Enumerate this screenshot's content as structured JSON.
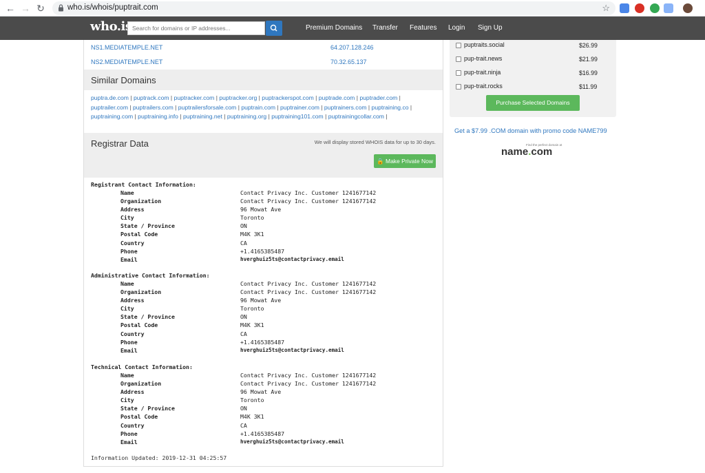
{
  "browser": {
    "url": "who.is/whois/puptrait.com"
  },
  "header": {
    "logo": "who.is",
    "search_placeholder": "Search for domains or IP addresses...",
    "nav": [
      "Premium Domains",
      "Transfer",
      "Features",
      "Login",
      "Sign Up"
    ]
  },
  "nameservers": [
    {
      "name": "NS1.MEDIATEMPLE.NET",
      "ip": "64.207.128.246"
    },
    {
      "name": "NS2.MEDIATEMPLE.NET",
      "ip": "70.32.65.137"
    }
  ],
  "similar": {
    "title": "Similar Domains",
    "domains": [
      "puptra.de.com",
      "puptrack.com",
      "puptracker.com",
      "puptracker.org",
      "puptrackerspot.com",
      "puptrade.com",
      "puptrader.com",
      "puptrailer.com",
      "puptrailers.com",
      "puptrailersforsale.com",
      "puptrain.com",
      "puptrainer.com",
      "puptrainers.com",
      "puptraining.co",
      "puptraining.com",
      "puptraining.info",
      "puptraining.net",
      "puptraining.org",
      "puptraining101.com",
      "puptrainingcollar.com"
    ]
  },
  "registrar": {
    "title": "Registrar Data",
    "note": "We will display stored WHOIS data for up to 30 days.",
    "private_button": "Make Private Now"
  },
  "contacts": [
    {
      "heading": "Registrant Contact Information:",
      "fields": [
        {
          "k": "Name",
          "v": "Contact Privacy Inc. Customer 1241677142"
        },
        {
          "k": "Organization",
          "v": "Contact Privacy Inc. Customer 1241677142"
        },
        {
          "k": "Address",
          "v": "96 Mowat Ave"
        },
        {
          "k": "City",
          "v": "Toronto"
        },
        {
          "k": "State / Province",
          "v": "ON"
        },
        {
          "k": "Postal Code",
          "v": "M4K 3K1"
        },
        {
          "k": "Country",
          "v": "CA"
        },
        {
          "k": "Phone",
          "v": "+1.4165385487"
        },
        {
          "k": "Email",
          "v": "hverghuiz5ts@contactprivacy.email"
        }
      ]
    },
    {
      "heading": "Administrative Contact Information:",
      "fields": [
        {
          "k": "Name",
          "v": "Contact Privacy Inc. Customer 1241677142"
        },
        {
          "k": "Organization",
          "v": "Contact Privacy Inc. Customer 1241677142"
        },
        {
          "k": "Address",
          "v": "96 Mowat Ave"
        },
        {
          "k": "City",
          "v": "Toronto"
        },
        {
          "k": "State / Province",
          "v": "ON"
        },
        {
          "k": "Postal Code",
          "v": "M4K 3K1"
        },
        {
          "k": "Country",
          "v": "CA"
        },
        {
          "k": "Phone",
          "v": "+1.4165385487"
        },
        {
          "k": "Email",
          "v": "hverghuiz5ts@contactprivacy.email"
        }
      ]
    },
    {
      "heading": "Technical Contact Information:",
      "fields": [
        {
          "k": "Name",
          "v": "Contact Privacy Inc. Customer 1241677142"
        },
        {
          "k": "Organization",
          "v": "Contact Privacy Inc. Customer 1241677142"
        },
        {
          "k": "Address",
          "v": "96 Mowat Ave"
        },
        {
          "k": "City",
          "v": "Toronto"
        },
        {
          "k": "State / Province",
          "v": "ON"
        },
        {
          "k": "Postal Code",
          "v": "M4K 3K1"
        },
        {
          "k": "Country",
          "v": "CA"
        },
        {
          "k": "Phone",
          "v": "+1.4165385487"
        },
        {
          "k": "Email",
          "v": "hverghuiz5ts@contactprivacy.email"
        }
      ]
    }
  ],
  "updated": "Information Updated: 2019-12-31 04:25:57",
  "side": {
    "options": [
      {
        "name": "puptraits.social",
        "price": "$26.99"
      },
      {
        "name": "pup-trait.news",
        "price": "$21.99"
      },
      {
        "name": "pup-trait.ninja",
        "price": "$16.99"
      },
      {
        "name": "pup-trait.rocks",
        "price": "$11.99"
      }
    ],
    "purchase_button": "Purchase Selected Domains",
    "promo": "Get a $7.99 .COM domain with promo code NAME799",
    "ad_tagline": "Find the perfect domain at",
    "ad_brand_left": "name",
    "ad_brand_dot": ".",
    "ad_brand_right": "com"
  },
  "colors": {
    "accent": "#2f77bf",
    "green": "#5cb85c",
    "header": "#4b4b4b"
  }
}
